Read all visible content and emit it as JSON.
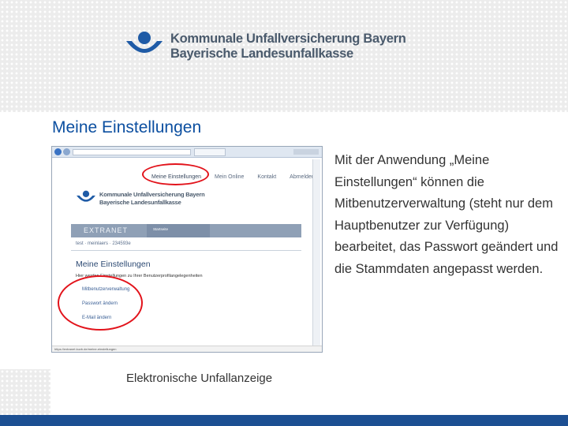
{
  "brand": {
    "line1": "Kommunale Unfallversicherung Bayern",
    "line2": "Bayerische Landesunfallkasse",
    "logo_icon": "kuvb-logo-icon",
    "colors": {
      "text": "#4a5a6c",
      "accent": "#1f5ba6"
    }
  },
  "slide": {
    "title": "Meine Einstellungen",
    "description": "Mit der Anwendung „Meine Einstellungen“ können die Mitbenutzerverwaltung (steht nur dem Hauptbenutzer zur Verfügung) bearbeitet, das Passwort geändert und die Stammdaten angepasst werden.",
    "footer": "Elektronische Unfallanzeige"
  },
  "screenshot": {
    "nav": [
      "Meine Einstellungen",
      "Mein Online",
      "Kontakt",
      "Abmelden"
    ],
    "logo_line1": "Kommunale Unfallversicherung Bayern",
    "logo_line2": "Bayerische Landesunfallkasse",
    "extranet_label": "EXTRANET",
    "extranet_user": "Startseite",
    "breadcrumb": "test   ·   meinlaers   ·   234593e",
    "heading": "Meine Einstellungen",
    "subtitle": "Hier werden Einstellungen zu Ihrer Benutzerprofilangelegenheiten",
    "links": [
      "Mitbenutzerverwaltung",
      "Passwort ändern",
      "E-Mail ändern"
    ],
    "status": "https://extranet.kuvb.de/meine-einstellungen"
  },
  "colors": {
    "title": "#0c4fa0",
    "highlight": "#e2131b",
    "footer_bar": "#1c4f92"
  }
}
